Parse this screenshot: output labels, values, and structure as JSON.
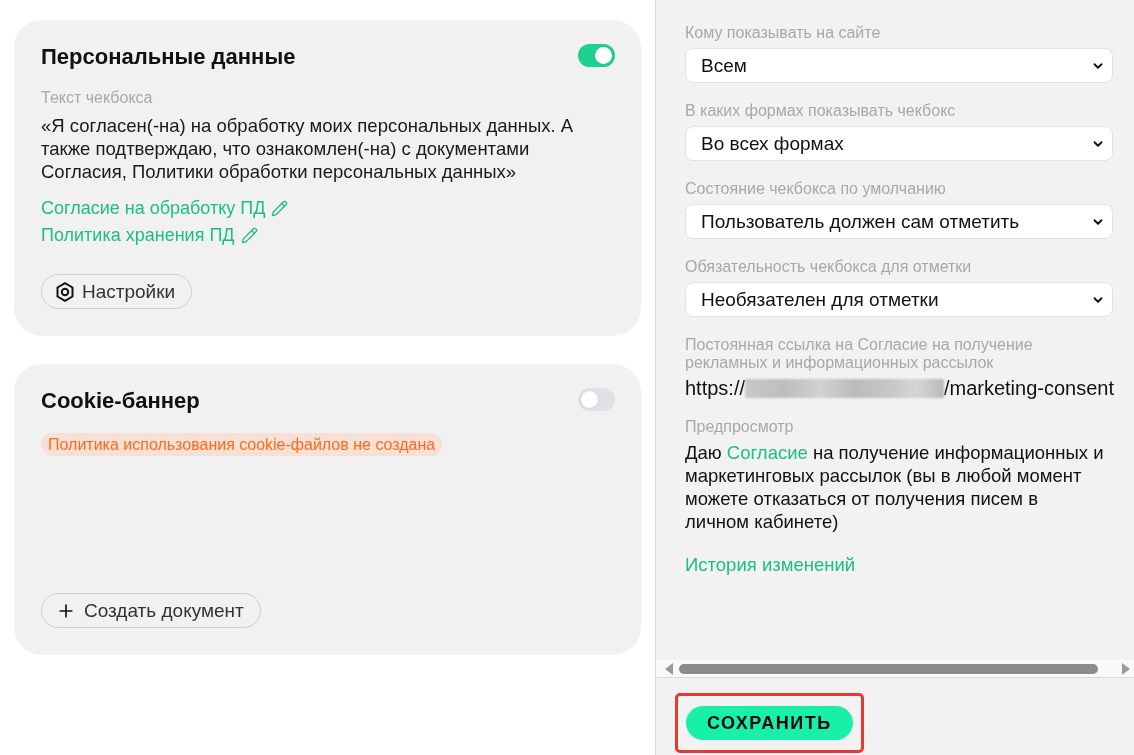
{
  "cards": [
    {
      "kind": "consent",
      "title": "Персональные данные",
      "on": true,
      "field_label": "Текст чекбокса",
      "text": "«Я согласен(-на) на обработку моих персональных данных. А также подтверждаю, что ознакомлен(-на) с документами Согласия, Политики обработки персональных данных»",
      "links": [
        "Согласие на обработку ПД",
        "Политика хранения ПД"
      ],
      "button": "Настройки"
    },
    {
      "kind": "cookie",
      "title": "Cookie-баннер",
      "on": false,
      "warning": "Политика использования cookie-файлов не создана",
      "button": "Создать документ"
    }
  ],
  "settings_panel": {
    "selects": [
      {
        "label": "Кому показывать на сайте",
        "value": "Всем"
      },
      {
        "label": "В каких формах показывать чекбокс",
        "value": "Во всех формах"
      },
      {
        "label": "Состояние чекбокса по умолчанию",
        "value": "Пользователь должен сам отметить"
      },
      {
        "label": "Обязательность чекбокса для отметки",
        "value": "Необязателен для отметки"
      }
    ],
    "permalink": {
      "label": "Постоянная ссылка на Согласие на получение рекламных и информационных рассылок",
      "prefix": "https://",
      "redacted": true,
      "suffix": "/marketing-consent"
    },
    "preview": {
      "label": "Предпросмотр",
      "before": "Даю",
      "link": "Согласие",
      "after": "на получение информационных и маркетинговых рассылок (вы в любой момент можете отказаться от получения писем в личном кабинете)"
    },
    "history_link": "История изменений"
  },
  "footer": {
    "save_button": {
      "label": "СОХРАНИТЬ",
      "highlighted": true
    }
  }
}
